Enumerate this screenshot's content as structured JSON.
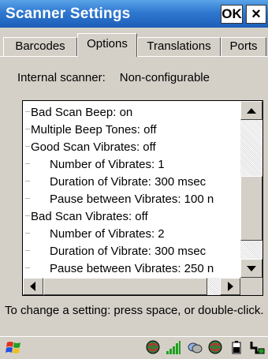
{
  "window": {
    "title": "Scanner Settings",
    "ok_label": "OK",
    "close_label": "×"
  },
  "tabs": [
    {
      "label": "Barcodes",
      "active": false
    },
    {
      "label": "Options",
      "active": true
    },
    {
      "label": "Translations",
      "active": false
    },
    {
      "label": "Ports",
      "active": false
    }
  ],
  "internal_scanner": {
    "label": "Internal scanner:",
    "value": "Non-configurable"
  },
  "settings": [
    {
      "text": "Bad Scan Beep: on"
    },
    {
      "text": "Multiple Beep Tones: off"
    },
    {
      "text": "Good Scan Vibrates: off"
    },
    {
      "text": "Number of Vibrates: 1"
    },
    {
      "text": "Duration of Vibrate: 300 msec"
    },
    {
      "text": "Pause between Vibrates: 100 n"
    },
    {
      "text": "Bad Scan Vibrates: off"
    },
    {
      "text": "Number of Vibrates: 2"
    },
    {
      "text": "Duration of Vibrate: 300 msec"
    },
    {
      "text": "Pause between Vibrates: 250 n"
    }
  ],
  "hint": "To change a setting: press space, or double-click.",
  "taskbar": {
    "start_icon": "windows-flag-icon",
    "tray_icons": [
      "globe-icon",
      "signal-bars-icon",
      "sync-icon",
      "globe-icon",
      "battery-icon",
      "power-plug-icon"
    ]
  },
  "colors": {
    "titlebar": "#2f78d0",
    "dialog_bg": "#d4d0c8",
    "list_bg": "#ffffff"
  }
}
